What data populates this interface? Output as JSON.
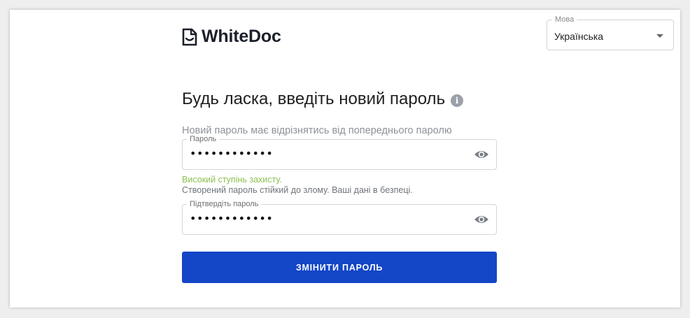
{
  "brand": {
    "name": "WhiteDoc",
    "logo_icon": "document-icon"
  },
  "language": {
    "label": "Мова",
    "selected": "Українська",
    "caret_icon": "chevron-down-icon"
  },
  "form": {
    "heading": "Будь ласка, введіть новий пароль",
    "info_icon": "info-icon",
    "info_glyph": "i",
    "subtitle": "Новий пароль має відрізнятись від попереднього паролю",
    "password": {
      "label": "Пароль",
      "value": "••••••••••••",
      "toggle_icon": "eye-icon"
    },
    "strength": {
      "level": "Високий ступінь захисту.",
      "description": "Створений пароль стійкий до злому. Ваші дані в безпеці."
    },
    "confirm": {
      "label": "Підтвердіть пароль",
      "value": "••••••••••••",
      "toggle_icon": "eye-icon"
    },
    "submit_label": "ЗМІНИТИ ПАРОЛЬ"
  },
  "colors": {
    "primary": "#1446c8",
    "strength_good": "#8cc152",
    "muted_text": "#8c9299"
  }
}
